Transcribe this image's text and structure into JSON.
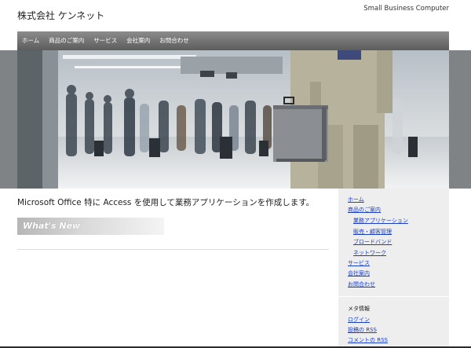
{
  "header": {
    "site_title": "株式会社 ケンネット",
    "tagline": "Small Business Computer"
  },
  "nav": {
    "items": [
      "ホーム",
      "商品のご案内",
      "サービス",
      "会社案内",
      "お問合わせ"
    ]
  },
  "main": {
    "intro": "Microsoft Office 特に Access を使用して業務アプリケーションを作成します。",
    "whats_new": "What's New"
  },
  "sidebar": {
    "menu": {
      "home": "ホーム",
      "products": "商品のご案内",
      "business_apps": "業務アプリケーション",
      "sales_customer": "販売・顧客管理",
      "broadband": "ブロードバンド",
      "network": "ネットワーク",
      "service": "サービス",
      "company": "会社案内",
      "contact": "お問合わせ"
    },
    "meta_heading": "メタ情報",
    "meta": {
      "login": "ログイン",
      "posts_rss": "投稿の RSS",
      "comments_rss": "コメントの RSS"
    }
  },
  "colors": {
    "nav_bg": "#6e6e6e",
    "link": "#1a3fc2",
    "sidebar_bg": "#eeeeee"
  }
}
